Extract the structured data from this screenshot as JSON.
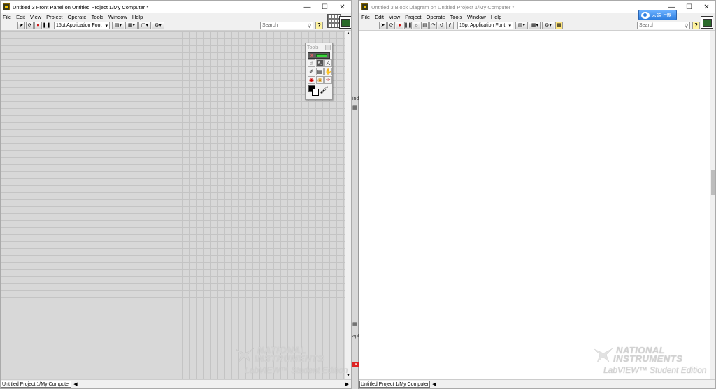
{
  "front_panel": {
    "title": "Untitled 3 Front Panel on Untitled Project 1/My Computer *",
    "menu": [
      "File",
      "Edit",
      "View",
      "Project",
      "Operate",
      "Tools",
      "Window",
      "Help"
    ],
    "font_selector": "15pt Application Font",
    "search_placeholder": "Search",
    "status_context": "Untitled Project 1/My Computer",
    "tools_palette": {
      "title": "Tools"
    },
    "watermark": {
      "line1": "NATIONAL",
      "line2": "INSTRUMENTS",
      "line3": "LabVIEW™ Student Edition"
    }
  },
  "block_diagram": {
    "title": "Untitled 3 Block Diagram on Untitled Project 1/My Computer *",
    "menu": [
      "File",
      "Edit",
      "View",
      "Project",
      "Operate",
      "Tools",
      "Window",
      "Help"
    ],
    "font_selector": "15pt Application Font",
    "search_placeholder": "Search",
    "status_context": "Untitled Project 1/My Computer",
    "cloud_button_label": "云端上传",
    "watermark": {
      "line1": "NATIONAL",
      "line2": "INSTRUMENTS",
      "line3": "LabVIEW™ Student Edition"
    }
  },
  "window_controls": {
    "minimize": "—",
    "maximize": "☐",
    "close": "✕"
  },
  "colors": {
    "grid_background": "#d8d8d8",
    "grid_line": "#c4c4c4",
    "diagram_background": "#ffffff",
    "cloud_button": "#2f7fe0"
  }
}
